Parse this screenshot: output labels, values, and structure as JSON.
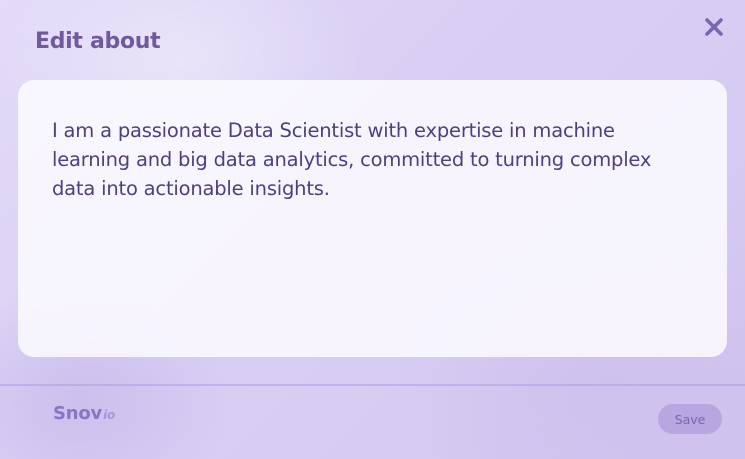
{
  "dialog": {
    "title": "Edit about",
    "close_icon": "close-icon",
    "about_text": "I am a passionate Data Scientist with expertise in machine learning and big data analytics, committed to turning complex data into actionable insights.",
    "save_label": "Save"
  },
  "brand": {
    "name": "Snov",
    "suffix": "io"
  },
  "colors": {
    "title": "#6f5a9e",
    "text": "#4f3e80",
    "background": "#d9cff4",
    "panel": "#fcfaff",
    "save_button": "#b7a6e0",
    "save_label": "#7a66b0",
    "brand": "#8a74c4"
  }
}
